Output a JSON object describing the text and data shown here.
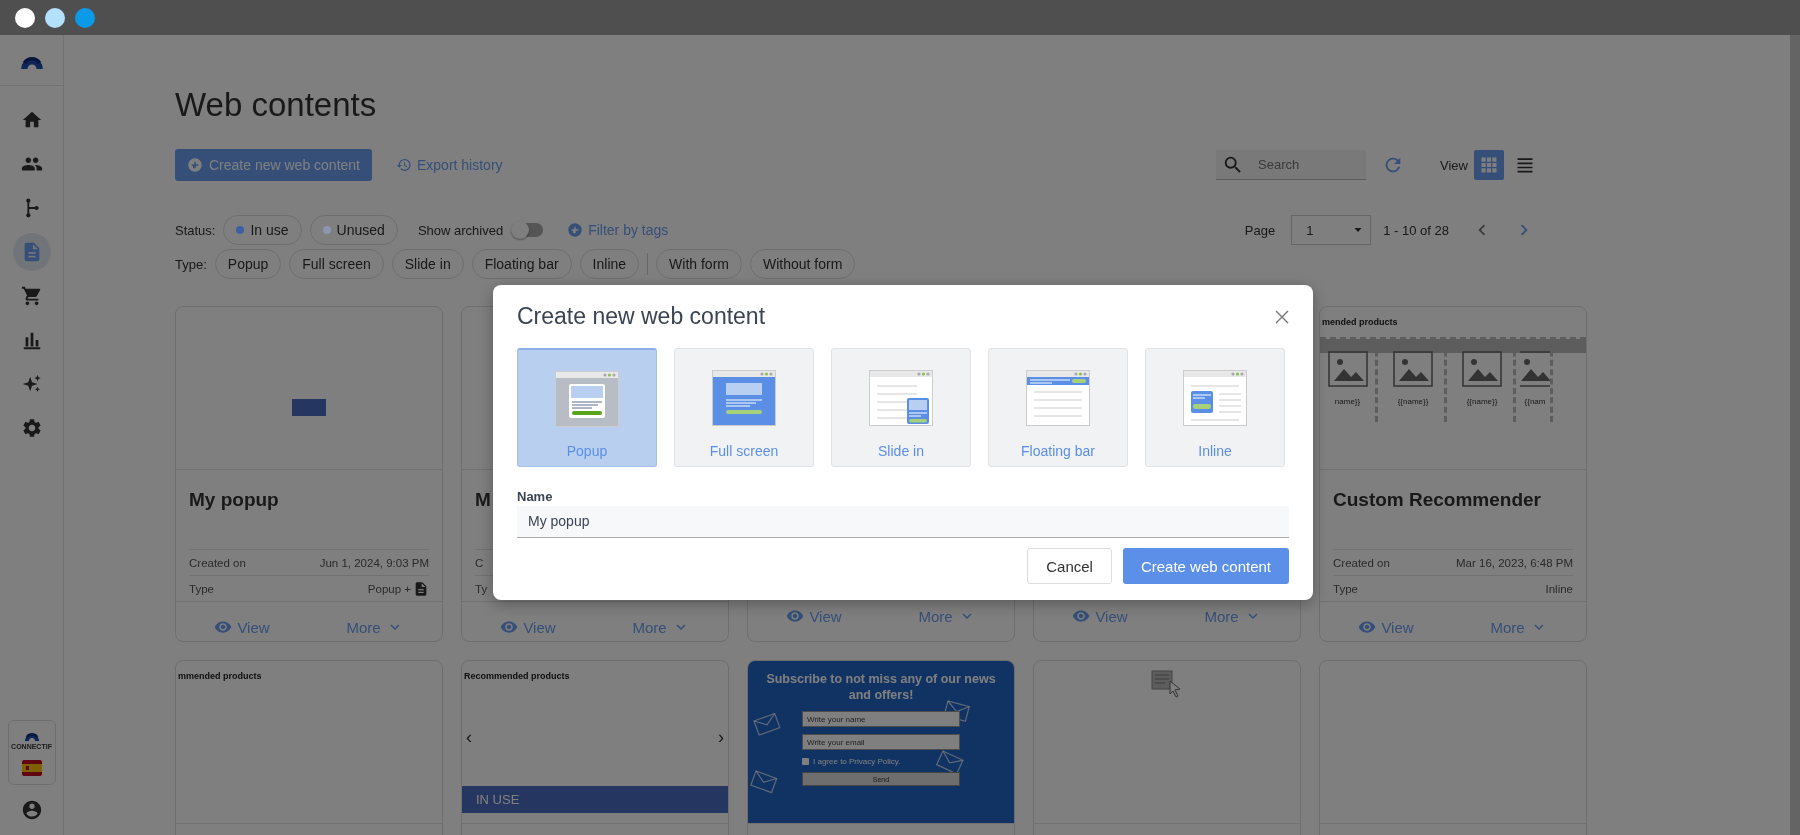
{
  "window_controls": [
    {
      "color": "#ffffff"
    },
    {
      "color": "#b3e0fb"
    },
    {
      "color": "#0a9ae8"
    }
  ],
  "sidebar": {
    "items": [
      {
        "kind": "home",
        "selected": false
      },
      {
        "kind": "people",
        "selected": false
      },
      {
        "kind": "branch",
        "selected": false
      },
      {
        "kind": "document",
        "selected": true
      },
      {
        "kind": "cart",
        "selected": false
      },
      {
        "kind": "chart",
        "selected": false
      },
      {
        "kind": "sparkle",
        "selected": false
      },
      {
        "kind": "settings",
        "selected": false
      }
    ],
    "brand_caption": "CONNECTIF"
  },
  "page": {
    "title": "Web contents",
    "create_button": "Create new web content",
    "export_link": "Export history",
    "search": {
      "placeholder": "Search"
    },
    "view_label": "View",
    "views": [
      {
        "kind": "grid",
        "selected": true
      },
      {
        "kind": "list",
        "selected": false
      }
    ]
  },
  "filters": {
    "status_label": "Status:",
    "statuses": [
      {
        "label": "In use",
        "color": "#3d5fa6"
      },
      {
        "label": "Unused",
        "color": "#8d96b0"
      }
    ],
    "show_archived": {
      "label": "Show archived",
      "on": false
    },
    "filter_tags": "Filter by tags",
    "type_label": "Type:",
    "types": [
      {
        "label": "Popup",
        "group_start": false
      },
      {
        "label": "Full screen",
        "group_start": false
      },
      {
        "label": "Slide in",
        "group_start": false
      },
      {
        "label": "Floating bar",
        "group_start": false
      },
      {
        "label": "Inline",
        "group_start": false
      },
      {
        "label": "With form",
        "group_start": true
      },
      {
        "label": "Without form",
        "group_start": false
      }
    ]
  },
  "pagination": {
    "label": "Page",
    "page": "1",
    "range": "1 - 10 of 28"
  },
  "cards": [
    {
      "preview": {
        "kind": "form"
      },
      "title": "My popup",
      "meta": [
        {
          "label": "Created on",
          "value": "Jun 1, 2024, 9:03 PM",
          "kind": "plain"
        },
        {
          "label": "Type",
          "value": "Popup +",
          "kind": "form"
        }
      ],
      "view": "View",
      "more": "More"
    },
    {
      "preview": {
        "kind": "blank"
      },
      "title": "M",
      "meta": [
        {
          "label": "C"
        },
        {
          "label": "Ty"
        }
      ],
      "view": "View",
      "more": "More"
    },
    {
      "preview": {
        "kind": "blank"
      },
      "view": "View",
      "more": "More"
    },
    {
      "preview": {
        "kind": "blank"
      },
      "view": "View",
      "more": "More"
    },
    {
      "preview": {
        "kind": "recommender",
        "heading": "mended products",
        "items": [
          "name}}",
          "{{name}}",
          "{{name}}",
          "{{nam"
        ]
      },
      "title": "Custom Recommender",
      "meta": [
        {
          "label": "Created on",
          "value": "Mar 16, 2023, 6:48 PM",
          "kind": "plain"
        },
        {
          "label": "Type",
          "value": "Inline",
          "kind": "plain"
        }
      ],
      "view": "View",
      "more": "More"
    },
    {
      "preview": {
        "kind": "heading",
        "heading": "mmended products"
      }
    },
    {
      "preview": {
        "kind": "carousel",
        "heading": "Recommended products",
        "prev": "‹",
        "next": "›",
        "banner": "IN USE"
      }
    },
    {
      "preview": {
        "kind": "subscribe",
        "heading": "Subscribe to not miss any of our news and offers!",
        "name_placeholder": "Write your name",
        "email_placeholder": "Write your email",
        "consent": "I agree to Privacy Policy.",
        "consent_checked": false,
        "send": "Send"
      }
    },
    {
      "preview": {
        "kind": "editor"
      }
    },
    {
      "preview": {
        "kind": "blank"
      }
    }
  ],
  "modal": {
    "title": "Create new web content",
    "types": [
      {
        "label": "Popup",
        "kind": "popup",
        "selected": true
      },
      {
        "label": "Full screen",
        "kind": "fullscreen",
        "selected": false
      },
      {
        "label": "Slide in",
        "kind": "slidein",
        "selected": false
      },
      {
        "label": "Floating bar",
        "kind": "floatingbar",
        "selected": false
      },
      {
        "label": "Inline",
        "kind": "inline",
        "selected": false
      }
    ],
    "name_label": "Name",
    "name_value": "My popup",
    "cancel": "Cancel",
    "submit": "Create web content"
  }
}
